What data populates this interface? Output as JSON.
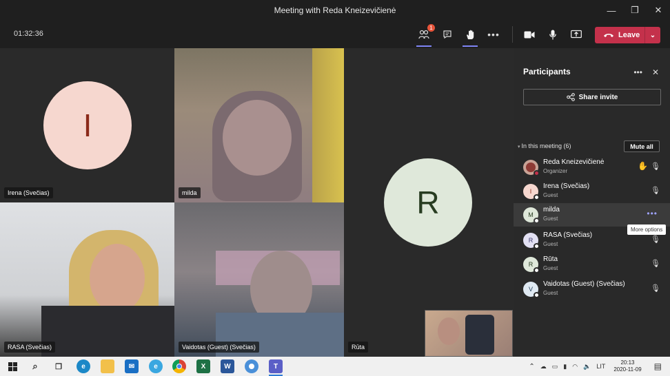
{
  "window": {
    "title": "Meeting with Reda Kneizevičienė",
    "controls": [
      "—",
      "❐",
      "✕"
    ]
  },
  "toolbar": {
    "timer": "01:32:36",
    "participants_badge": "1",
    "leave_label": "Leave"
  },
  "tiles": [
    {
      "name": "Irena (Svečias)",
      "initial": "I"
    },
    {
      "name": "milda"
    },
    {
      "name": "Rūta",
      "initial": "R"
    },
    {
      "name": "RASA (Svečias)"
    },
    {
      "name": "Vaidotas (Guest) (Svečias)"
    }
  ],
  "panel": {
    "title": "Participants",
    "share_label": "Share invite",
    "section_label": "In this meeting (6)",
    "mute_all_label": "Mute all",
    "participants": [
      {
        "initial": "",
        "name": "Reda Kneizevičienė",
        "role": "Organizer"
      },
      {
        "initial": "I",
        "name": "Irena (Svečias)",
        "role": "Guest"
      },
      {
        "initial": "M",
        "name": "milda",
        "role": "Guest"
      },
      {
        "initial": "R",
        "name": "RASA (Svečias)",
        "role": "Guest"
      },
      {
        "initial": "R",
        "name": "Rūta",
        "role": "Guest"
      },
      {
        "initial": "V",
        "name": "Vaidotas (Guest) (Svečias)",
        "role": "Guest"
      }
    ],
    "tooltip": "More options"
  },
  "taskbar": {
    "language": "LIT",
    "time": "20:13",
    "date": "2020-11-09"
  },
  "colors": {
    "leave": "#c4314b",
    "accent": "#7f85f5",
    "avatar_irena": "#f6d7cf",
    "avatar_ruta": "#dfe8da"
  }
}
